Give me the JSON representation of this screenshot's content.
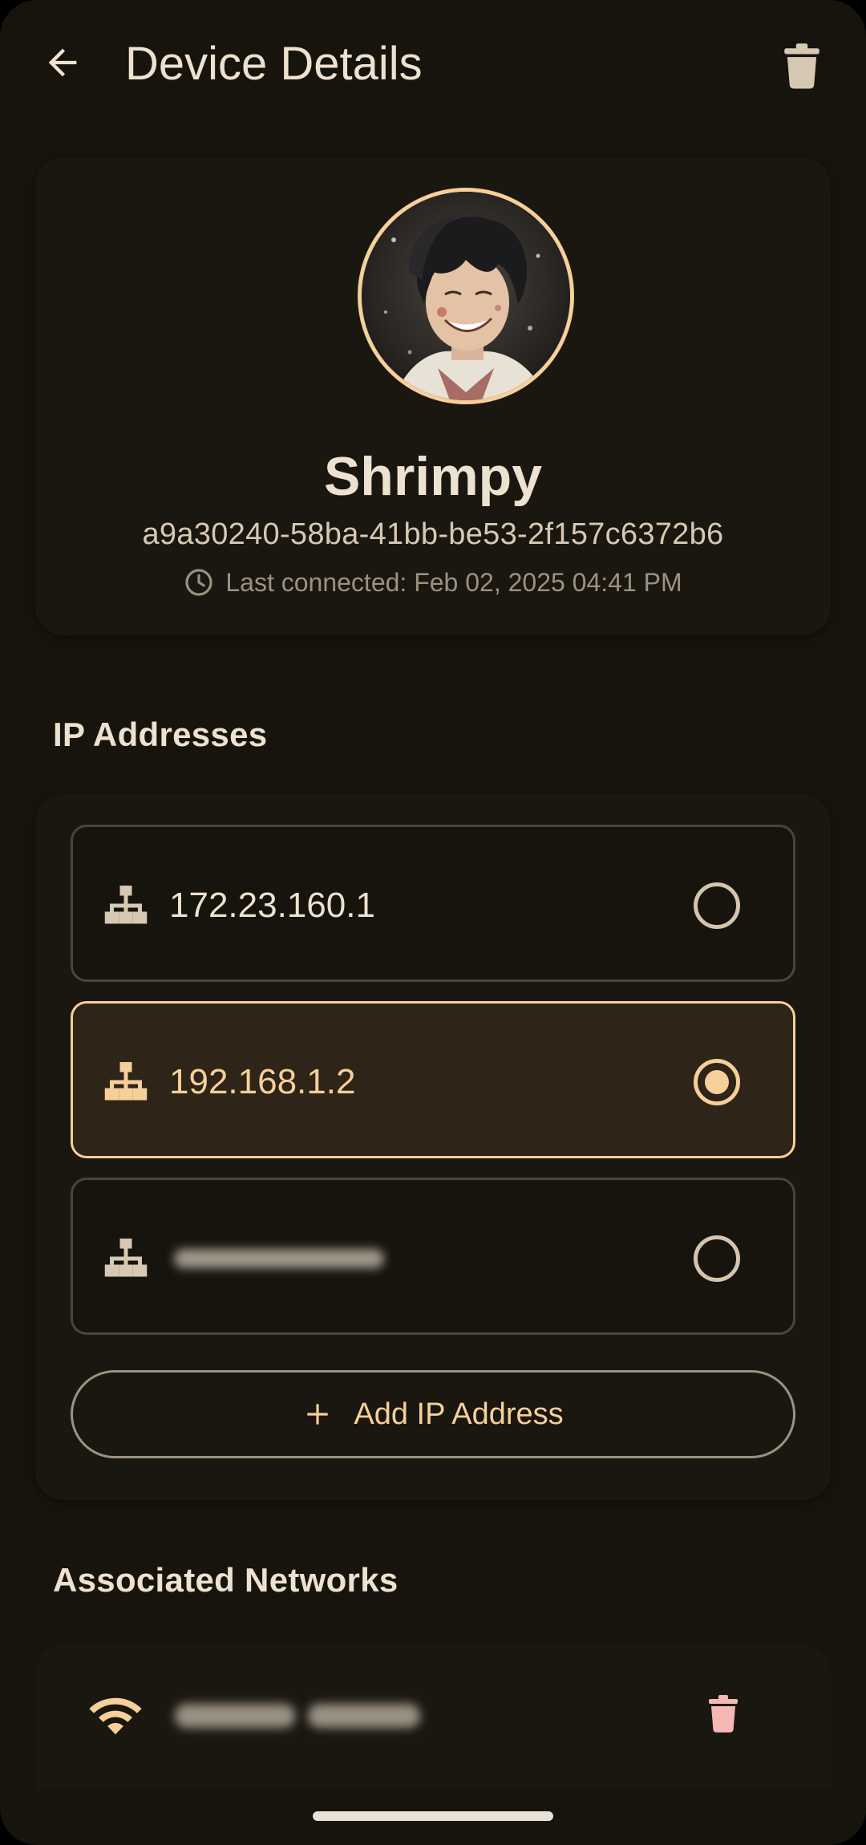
{
  "appbar": {
    "title": "Device Details",
    "back_icon": "arrow-back-icon",
    "delete_icon": "trash-icon"
  },
  "device": {
    "name": "Shrimpy",
    "id": "a9a30240-58ba-41bb-be53-2f157c6372b6",
    "last_connected": "Last connected: Feb 02, 2025 04:41 PM",
    "avatar": "anime-character-avatar"
  },
  "ip_section": {
    "title": "IP Addresses",
    "items": [
      {
        "address": "172.23.160.1",
        "selected": false
      },
      {
        "address": "192.168.1.2",
        "selected": true
      },
      {
        "address": "",
        "selected": false,
        "redacted": true
      }
    ],
    "add_label": "Add IP Address"
  },
  "networks_section": {
    "title": "Associated Networks",
    "items": [
      {
        "name": "",
        "redacted": true,
        "icon": "wifi-icon"
      }
    ]
  },
  "colors": {
    "background": "#17140e",
    "surface": "#1a1711",
    "accent": "#f6cf9a",
    "text": "#ede1cf",
    "delete": "#f5b8b4"
  }
}
